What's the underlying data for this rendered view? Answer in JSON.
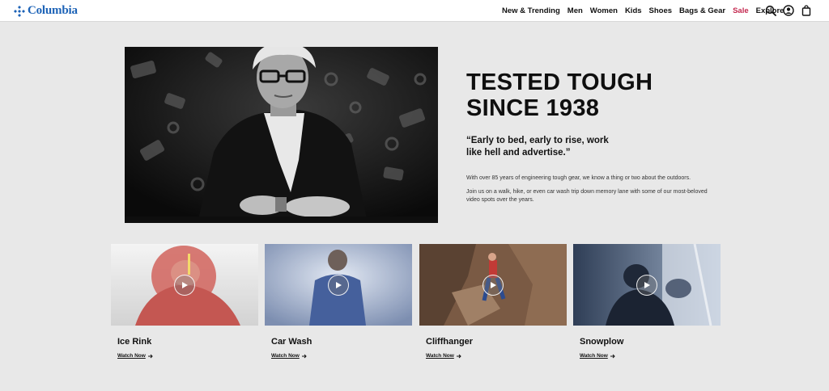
{
  "brand": {
    "name": "Columbia",
    "color": "#1d63b7"
  },
  "nav": {
    "items": [
      "New & Trending",
      "Men",
      "Women",
      "Kids",
      "Shoes",
      "Bags & Gear",
      "Sale",
      "Explore"
    ],
    "sale_color": "#c4284f"
  },
  "header_icons": [
    "search-icon",
    "account-icon",
    "shopping-bag-icon"
  ],
  "hero": {
    "title_line1": "TESTED TOUGH",
    "title_line2": "SINCE 1938",
    "quote": "“Early to bed, early to rise, work like hell and advertise.”",
    "paragraph1": "With over 85 years of engineering tough gear, we know a thing or two about the outdoors.",
    "paragraph2": "Join us on a walk, hike, or even car wash trip down memory lane with some of our most-beloved video spots over the years."
  },
  "videos": [
    {
      "title": "Ice Rink",
      "link": "Watch Now"
    },
    {
      "title": "Car Wash",
      "link": "Watch Now"
    },
    {
      "title": "Cliffhanger",
      "link": "Watch Now"
    },
    {
      "title": "Snowplow",
      "link": "Watch Now"
    }
  ]
}
